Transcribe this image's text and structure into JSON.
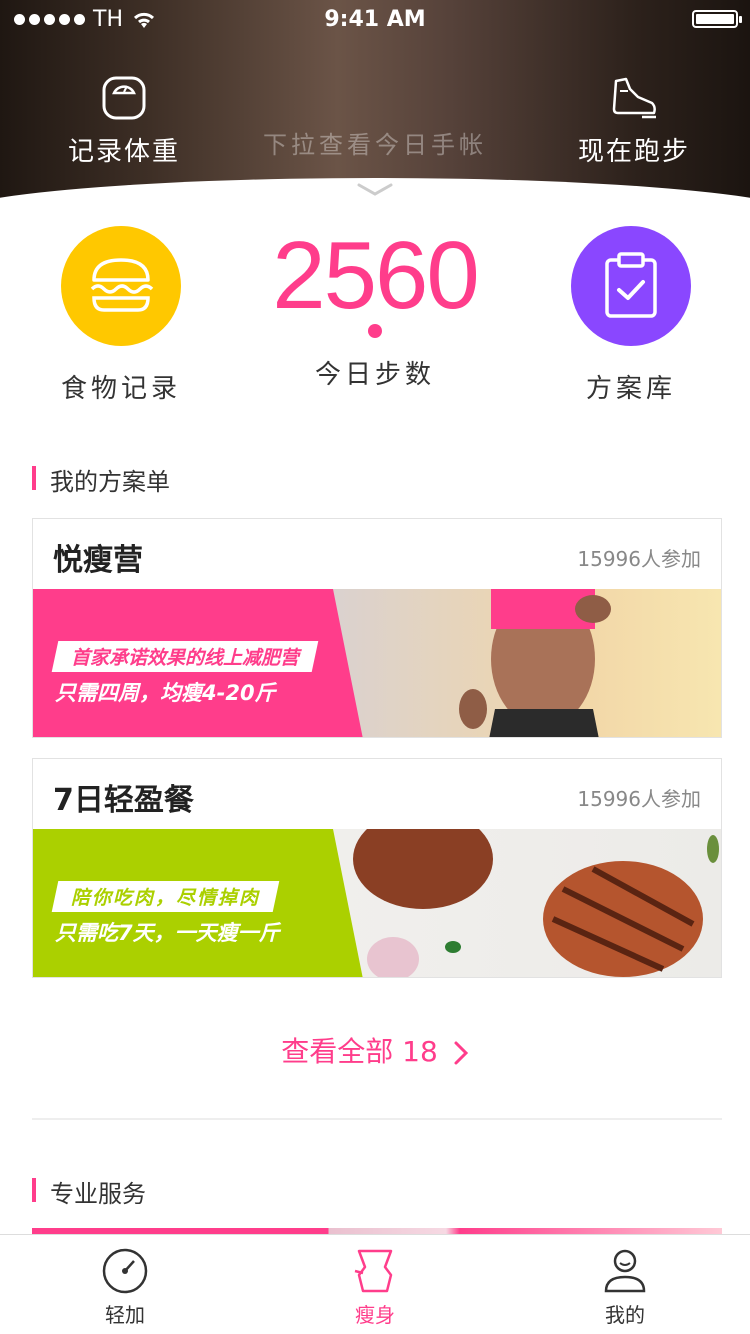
{
  "status_bar": {
    "carrier": "TH",
    "time": "9:41 AM"
  },
  "header": {
    "left_action": "记录体重",
    "right_action": "现在跑步",
    "pull_hint": "下拉查看今日手帐"
  },
  "quick": {
    "food": "食物记录",
    "steps_value": "2560",
    "steps_label": "今日步数",
    "plans": "方案库"
  },
  "my_plans": {
    "title": "我的方案单",
    "cards": [
      {
        "name": "悦瘦营",
        "participants": "15996人参加",
        "tag": "首家承诺效果的线上减肥营",
        "subtitle": "只需四周，均瘦4-20斤",
        "accent": "#ff3d8b"
      },
      {
        "name": "7日轻盈餐",
        "participants": "15996人参加",
        "tag": "陪你吃肉，尽情掉肉",
        "subtitle": "只需吃7天，一天瘦一斤",
        "accent": "#abd000"
      }
    ],
    "view_all": "查看全部 18"
  },
  "services": {
    "title": "专业服务"
  },
  "tabbar": {
    "items": [
      {
        "label": "轻加",
        "icon": "gauge-icon"
      },
      {
        "label": "瘦身",
        "icon": "body-icon"
      },
      {
        "label": "我的",
        "icon": "profile-icon"
      }
    ],
    "active_index": 1
  },
  "colors": {
    "accent": "#ff3d8b",
    "food": "#ffc800",
    "plans": "#8a47ff",
    "lime": "#abd000"
  }
}
